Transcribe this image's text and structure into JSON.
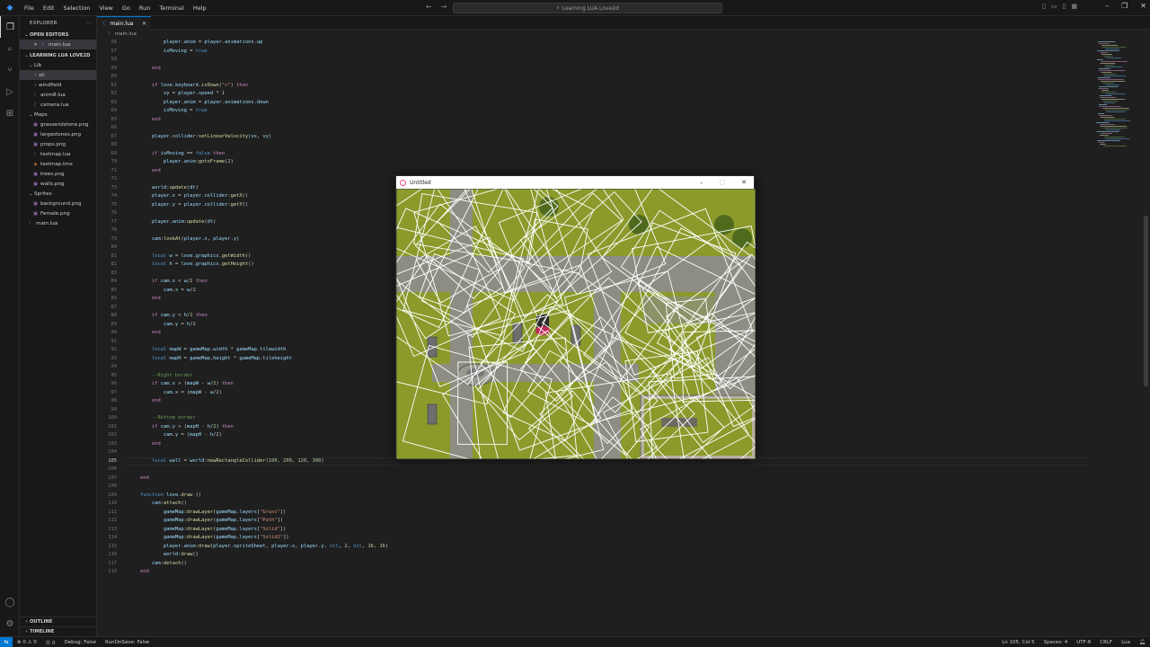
{
  "titlebar": {
    "menu": [
      "File",
      "Edit",
      "Selection",
      "View",
      "Go",
      "Run",
      "Terminal",
      "Help"
    ],
    "search": "Learning LUA Love2d"
  },
  "sidebar": {
    "title": "EXPLORER",
    "open_editors": "OPEN EDITORS",
    "open_file": "main.lua",
    "project": "LEARNING LUA LOVE2D",
    "tree": [
      {
        "label": "Lib",
        "type": "folder",
        "depth": 1,
        "open": true
      },
      {
        "label": "sti",
        "type": "folder",
        "depth": 2,
        "open": false,
        "selected": true
      },
      {
        "label": "windfield",
        "type": "folder",
        "depth": 2,
        "open": false
      },
      {
        "label": "anim8.lua",
        "type": "lua",
        "depth": 2
      },
      {
        "label": "camera.lua",
        "type": "lua",
        "depth": 2
      },
      {
        "label": "Maps",
        "type": "folder",
        "depth": 1,
        "open": true
      },
      {
        "label": "grassandstone.png",
        "type": "png",
        "depth": 2
      },
      {
        "label": "largestones.png",
        "type": "png",
        "depth": 2
      },
      {
        "label": "props.png",
        "type": "png",
        "depth": 2
      },
      {
        "label": "testmap.lua",
        "type": "lua",
        "depth": 2
      },
      {
        "label": "testmap.tmx",
        "type": "tmx",
        "depth": 2
      },
      {
        "label": "trees.png",
        "type": "png",
        "depth": 2
      },
      {
        "label": "walls.png",
        "type": "png",
        "depth": 2
      },
      {
        "label": "Sprites",
        "type": "folder",
        "depth": 1,
        "open": true
      },
      {
        "label": "background.png",
        "type": "png",
        "depth": 2
      },
      {
        "label": "Female.png",
        "type": "png",
        "depth": 2
      },
      {
        "label": "main.lua",
        "type": "lua",
        "depth": 1
      }
    ],
    "outline": "OUTLINE",
    "timeline": "TIMELINE"
  },
  "editor": {
    "tab": "main.lua",
    "breadcrumb": "main.lua",
    "current_line": 105,
    "lines": [
      {
        "n": 56,
        "t": "            player.anim = player.animations.up"
      },
      {
        "n": 57,
        "t": "            isMoving = true"
      },
      {
        "n": 58,
        "t": ""
      },
      {
        "n": 59,
        "t": "        end"
      },
      {
        "n": 60,
        "t": ""
      },
      {
        "n": 61,
        "t": "        if love.keyboard.isDown(\"s\") then"
      },
      {
        "n": 62,
        "t": "            vy = player.speed * 1"
      },
      {
        "n": 63,
        "t": "            player.anim = player.animations.down"
      },
      {
        "n": 64,
        "t": "            isMoving = true"
      },
      {
        "n": 65,
        "t": "        end"
      },
      {
        "n": 66,
        "t": ""
      },
      {
        "n": 67,
        "t": "        player.collider:setLinearVelocity(vx, vy)"
      },
      {
        "n": 68,
        "t": ""
      },
      {
        "n": 69,
        "t": "        if isMoving == false then"
      },
      {
        "n": 70,
        "t": "            player.anim:gotoFrame(2)"
      },
      {
        "n": 71,
        "t": "        end"
      },
      {
        "n": 72,
        "t": ""
      },
      {
        "n": 73,
        "t": "        world:update(dt)"
      },
      {
        "n": 74,
        "t": "        player.x = player.collider:getX()"
      },
      {
        "n": 75,
        "t": "        player.y = player.collider:getY()"
      },
      {
        "n": 76,
        "t": ""
      },
      {
        "n": 77,
        "t": "        player.anim:update(dt)"
      },
      {
        "n": 78,
        "t": ""
      },
      {
        "n": 79,
        "t": "        cam:lookAt(player.x, player.y)"
      },
      {
        "n": 80,
        "t": ""
      },
      {
        "n": 81,
        "t": "        local w = love.graphics.getWidth()"
      },
      {
        "n": 82,
        "t": "        local h = love.graphics.getHeight()"
      },
      {
        "n": 83,
        "t": ""
      },
      {
        "n": 84,
        "t": "        if cam.x < w/2 then"
      },
      {
        "n": 85,
        "t": "            cam.x = w/2"
      },
      {
        "n": 86,
        "t": "        end"
      },
      {
        "n": 87,
        "t": ""
      },
      {
        "n": 88,
        "t": "        if cam.y < h/2 then"
      },
      {
        "n": 89,
        "t": "            cam.y = h/2"
      },
      {
        "n": 90,
        "t": "        end"
      },
      {
        "n": 91,
        "t": ""
      },
      {
        "n": 92,
        "t": "        local mapW = gameMap.width * gameMap.tilewidth"
      },
      {
        "n": 93,
        "t": "        local mapH = gameMap.height * gameMap.tileheight"
      },
      {
        "n": 94,
        "t": ""
      },
      {
        "n": 95,
        "t": "        --Right border"
      },
      {
        "n": 96,
        "t": "        if cam.x > (mapW - w/2) then"
      },
      {
        "n": 97,
        "t": "            cam.x = (mapW - w/2)"
      },
      {
        "n": 98,
        "t": "        end"
      },
      {
        "n": 99,
        "t": ""
      },
      {
        "n": 100,
        "t": "        --Bottom border"
      },
      {
        "n": 101,
        "t": "        if cam.y > (mapH - h/2) then"
      },
      {
        "n": 102,
        "t": "            cam.y = (mapH - h/2)"
      },
      {
        "n": 103,
        "t": "        end"
      },
      {
        "n": 104,
        "t": ""
      },
      {
        "n": 105,
        "t": "        local wall = world:newRectangleCollider(100, 200, 120, 300)"
      },
      {
        "n": 106,
        "t": ""
      },
      {
        "n": 107,
        "t": "    end"
      },
      {
        "n": 108,
        "t": ""
      },
      {
        "n": 109,
        "t": "    function love.draw ()"
      },
      {
        "n": 110,
        "t": "        cam:attach()"
      },
      {
        "n": 111,
        "t": "            gameMap:drawLayer(gameMap.layers[\"Grass\"])"
      },
      {
        "n": 112,
        "t": "            gameMap:drawLayer(gameMap.layers[\"Path\"])"
      },
      {
        "n": 113,
        "t": "            gameMap:drawLayer(gameMap.layers[\"Solid\"])"
      },
      {
        "n": 114,
        "t": "            gameMap:drawLayer(gameMap.layers[\"Solid2\"])"
      },
      {
        "n": 115,
        "t": "            player.anim:draw(player.spriteSheet, player.x, player.y, nil, 2, nil, 16, 16)"
      },
      {
        "n": 116,
        "t": "            world:draw()"
      },
      {
        "n": 117,
        "t": "        cam:detach()"
      },
      {
        "n": 118,
        "t": "    end"
      }
    ]
  },
  "game_window": {
    "title": "Untitled"
  },
  "statusbar": {
    "errors": "⊗ 0 ⚠ 0",
    "info": "⓪ 0",
    "debug": "Debug: False",
    "runonsave": "RunOnSave: False",
    "position": "Ln 105, Col 5",
    "spaces": "Spaces: 4",
    "encoding": "UTF-8",
    "eol": "CRLF",
    "language": "Lua"
  },
  "colors": {
    "accent": "#0078d4",
    "grass": "#8b9a2b",
    "stone": "#8d8d83"
  }
}
